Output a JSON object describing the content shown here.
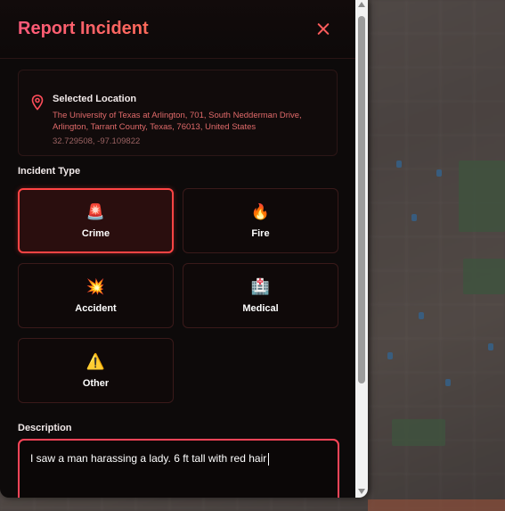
{
  "panel": {
    "title": "Report Incident"
  },
  "location": {
    "title": "Selected Location",
    "address": "The University of Texas at Arlington, 701, South Nedderman Drive, Arlington, Tarrant County, Texas, 76013, United States",
    "coords": "32.729508, -97.109822"
  },
  "incident_type": {
    "label": "Incident Type",
    "options": [
      {
        "label": "Crime",
        "emoji": "🚨",
        "selected": true
      },
      {
        "label": "Fire",
        "emoji": "🔥",
        "selected": false
      },
      {
        "label": "Accident",
        "emoji": "💥",
        "selected": false
      },
      {
        "label": "Medical",
        "emoji": "🏥",
        "selected": false
      },
      {
        "label": "Other",
        "emoji": "⚠️",
        "selected": false
      }
    ]
  },
  "description": {
    "label": "Description",
    "value": "I saw a man harassing a lady. 6 ft tall with red hair"
  },
  "colors": {
    "accent": "#ff4d6d",
    "selected_border": "#ff4444",
    "panel_bg": "#0d0a0a"
  },
  "icons": {
    "close": "close-icon",
    "location": "map-pin-icon"
  }
}
